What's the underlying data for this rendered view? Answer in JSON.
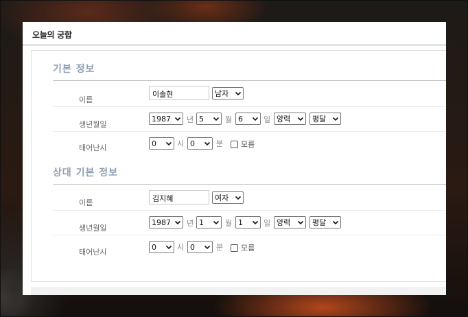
{
  "card": {
    "title": "오늘의 궁합"
  },
  "sections": [
    {
      "title": "기본 정보",
      "name_label": "이름",
      "name_value": "이솔현",
      "gender": "남자",
      "birth_label": "생년월일",
      "year": "1987",
      "year_unit": "년",
      "month": "5",
      "month_unit": "월",
      "day": "6",
      "day_unit": "일",
      "calendar": "양력",
      "leap": "평달",
      "time_label": "태어난시",
      "hour": "0",
      "hour_unit": "시",
      "minute": "0",
      "minute_unit": "분",
      "unknown_label": "모름"
    },
    {
      "title": "상대 기본 정보",
      "name_label": "이름",
      "name_value": "김지혜",
      "gender": "여자",
      "birth_label": "생년월일",
      "year": "1987",
      "year_unit": "년",
      "month": "1",
      "month_unit": "월",
      "day": "1",
      "day_unit": "일",
      "calendar": "양력",
      "leap": "평달",
      "time_label": "태어난시",
      "hour": "0",
      "hour_unit": "시",
      "minute": "0",
      "minute_unit": "분",
      "unknown_label": "모름"
    }
  ]
}
